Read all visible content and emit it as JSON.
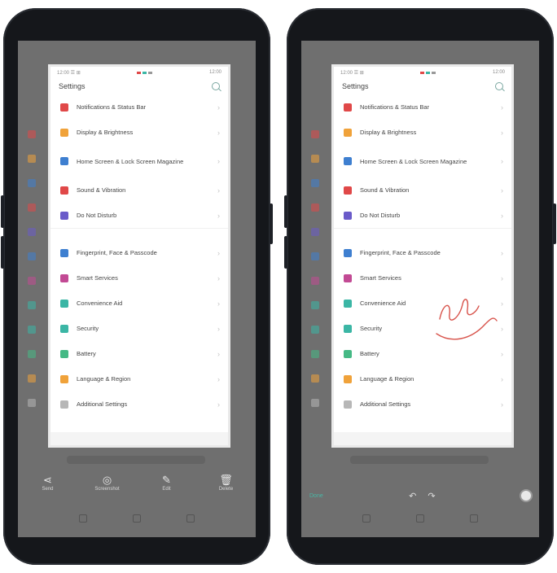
{
  "colors": {
    "red": "#e04848",
    "orange": "#f0a23a",
    "blue": "#3e7fd0",
    "purple": "#6a5bc9",
    "teal": "#3bb6a5",
    "green": "#45b985",
    "gray": "#b7b7b7",
    "magenta": "#c24a94",
    "pen": "#d8544c",
    "accent": "#48b8a6"
  },
  "left": {
    "status": {
      "left": "12:00 ☰ ⊞",
      "right": "12:00"
    },
    "title": "Settings",
    "items": [
      {
        "label": "Notifications & Status Bar",
        "icon": "bell-icon"
      },
      {
        "label": "Display & Brightness",
        "icon": "sun-icon"
      },
      {
        "label": "Home Screen & Lock Screen Magazine",
        "icon": "grid-icon"
      },
      {
        "label": "Sound & Vibration",
        "icon": "speaker-icon"
      },
      {
        "label": "Do Not Disturb",
        "icon": "moon-icon"
      },
      {
        "label": "Fingerprint, Face & Passcode",
        "icon": "fingerprint-icon"
      },
      {
        "label": "Smart Services",
        "icon": "sparkle-icon"
      },
      {
        "label": "Convenience Aid",
        "icon": "hand-icon"
      },
      {
        "label": "Security",
        "icon": "shield-icon"
      },
      {
        "label": "Battery",
        "icon": "battery-icon"
      },
      {
        "label": "Language & Region",
        "icon": "globe-icon"
      },
      {
        "label": "Additional Settings",
        "icon": "gear-icon"
      }
    ],
    "actions": [
      {
        "label": "Send",
        "icon": "share-icon",
        "glyph": "⋖"
      },
      {
        "label": "Screenshot",
        "icon": "scroll-capture-icon",
        "glyph": "◎"
      },
      {
        "label": "Edit",
        "icon": "edit-icon",
        "glyph": "✎"
      },
      {
        "label": "Delete",
        "icon": "trash-icon",
        "glyph": "🗑"
      }
    ]
  },
  "right": {
    "status": {
      "left": "12:00 ☰ ⊞",
      "right": "12:00"
    },
    "title": "Settings",
    "items": [
      {
        "label": "Notifications & Status Bar",
        "icon": "bell-icon"
      },
      {
        "label": "Display & Brightness",
        "icon": "sun-icon"
      },
      {
        "label": "Home Screen & Lock Screen Magazine",
        "icon": "grid-icon"
      },
      {
        "label": "Sound & Vibration",
        "icon": "speaker-icon"
      },
      {
        "label": "Do Not Disturb",
        "icon": "moon-icon"
      },
      {
        "label": "Fingerprint, Face & Passcode",
        "icon": "fingerprint-icon"
      },
      {
        "label": "Smart Services",
        "icon": "sparkle-icon"
      },
      {
        "label": "Convenience Aid",
        "icon": "hand-icon"
      },
      {
        "label": "Security",
        "icon": "shield-icon"
      },
      {
        "label": "Battery",
        "icon": "battery-icon"
      },
      {
        "label": "Language & Region",
        "icon": "globe-icon"
      },
      {
        "label": "Additional Settings",
        "icon": "gear-icon"
      }
    ],
    "edit": {
      "done": "Done",
      "undo_glyph": "↶",
      "redo_glyph": "↷"
    }
  }
}
